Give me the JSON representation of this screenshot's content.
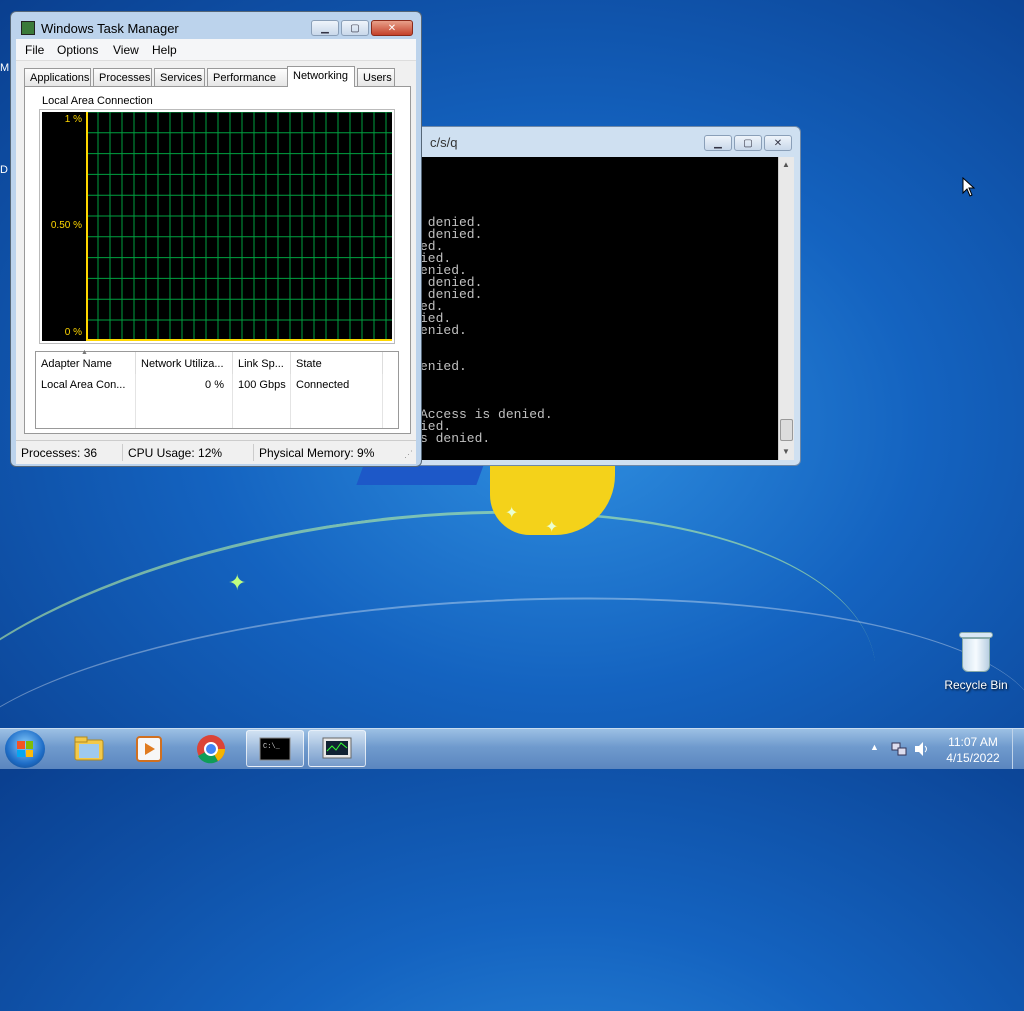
{
  "desktop": {
    "edge_labels": [
      "M",
      "D"
    ],
    "recycle_bin_label": "Recycle Bin"
  },
  "cmd_window": {
    "title": "c/s/q",
    "lines": [
      " denied.",
      " denied.",
      "ed.",
      "ied.",
      "enied.",
      " denied.",
      " denied.",
      "ed.",
      "ied.",
      "enied.",
      "",
      "",
      "enied.",
      "",
      "",
      "",
      "Access is denied.",
      "ied.",
      "s denied."
    ]
  },
  "task_manager": {
    "title": "Windows Task Manager",
    "menu": [
      "File",
      "Options",
      "View",
      "Help"
    ],
    "tabs": [
      "Applications",
      "Processes",
      "Services",
      "Performance",
      "Networking",
      "Users"
    ],
    "active_tab": "Networking",
    "connection_label": "Local Area Connection",
    "graph": {
      "y_labels": [
        "1 %",
        "0.50 %",
        "0 %"
      ],
      "grid_color": "#00a040",
      "axis_color": "#ffd700"
    },
    "columns": [
      "Adapter Name",
      "Network Utiliza...",
      "Link Sp...",
      "State"
    ],
    "rows": [
      {
        "adapter": "Local Area Con...",
        "utilization": "0 %",
        "link_speed": "100 Gbps",
        "state": "Connected"
      }
    ],
    "status": {
      "processes": "Processes: 36",
      "cpu": "CPU Usage: 12%",
      "memory": "Physical Memory: 9%"
    }
  },
  "taskbar": {
    "pinned": [
      "explorer-icon",
      "media-player-icon",
      "chrome-icon",
      "cmd-icon",
      "task-manager-icon"
    ],
    "clock_time": "11:07 AM",
    "clock_date": "4/15/2022"
  }
}
